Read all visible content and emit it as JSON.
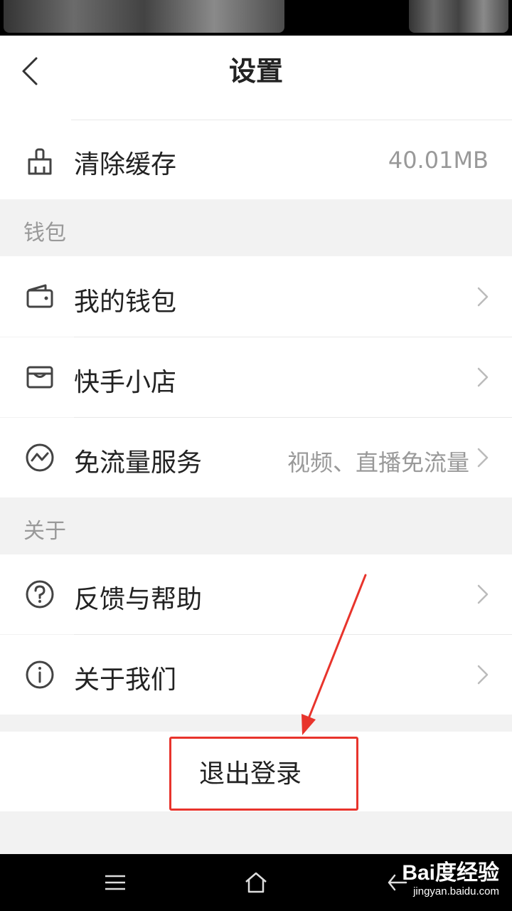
{
  "header": {
    "title": "设置"
  },
  "cache": {
    "label": "清除缓存",
    "value": "40.01MB"
  },
  "sections": {
    "wallet": {
      "title": "钱包",
      "items": [
        {
          "label": "我的钱包",
          "value": ""
        },
        {
          "label": "快手小店",
          "value": ""
        },
        {
          "label": "免流量服务",
          "value": "视频、直播免流量"
        }
      ]
    },
    "about": {
      "title": "关于",
      "items": [
        {
          "label": "反馈与帮助",
          "value": ""
        },
        {
          "label": "关于我们",
          "value": ""
        }
      ]
    }
  },
  "logout": {
    "label": "退出登录"
  },
  "watermark": {
    "brand": "Bai度经验",
    "url": "jingyan.baidu.com"
  },
  "colors": {
    "annotation": "#e8342c",
    "secondary_text": "#999999",
    "section_bg": "#f2f2f2"
  },
  "icons": [
    "back-chevron-icon",
    "broom-icon",
    "wallet-icon",
    "store-icon",
    "data-wave-icon",
    "question-circle-icon",
    "info-circle-icon",
    "menu-icon",
    "home-icon",
    "back-icon"
  ]
}
